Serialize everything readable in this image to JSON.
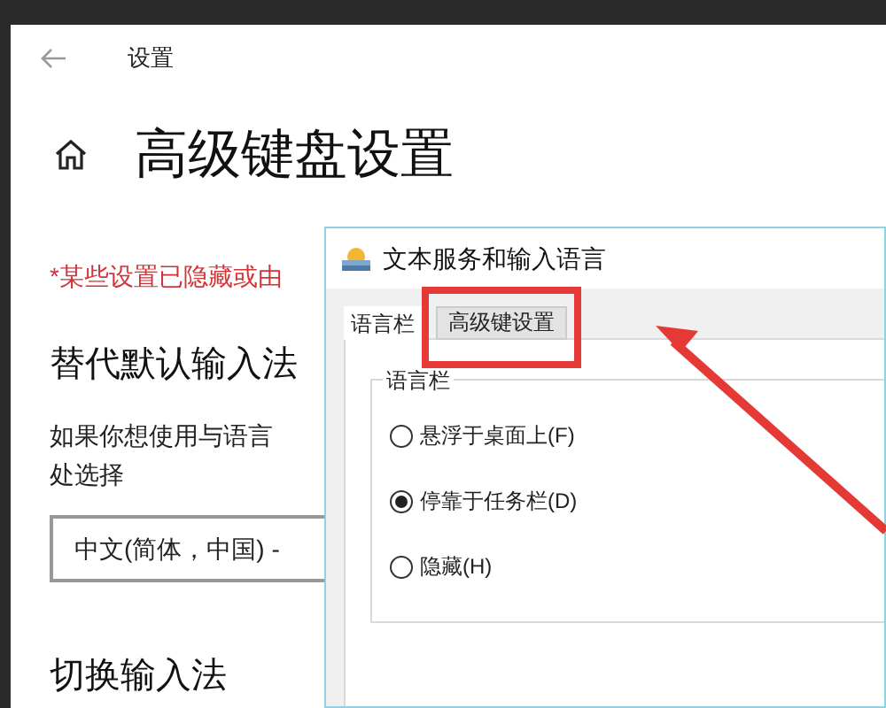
{
  "settings": {
    "header": "设置",
    "title": "高级键盘设置",
    "notice": "*某些设置已隐藏或由",
    "section_1": "替代默认输入法",
    "description_lines": [
      "如果你想使用与语言",
      "处选择"
    ],
    "dropdown": {
      "value": "中文(简体，中国) -"
    },
    "section_2": "切换输入法"
  },
  "dialog": {
    "title": "文本服务和输入语言",
    "tabs": [
      {
        "label": "语言栏",
        "selected": true,
        "highlighted": false
      },
      {
        "label": "高级键设置",
        "selected": false,
        "highlighted": true
      }
    ],
    "group": {
      "label": "语言栏",
      "options": [
        {
          "label": "悬浮于桌面上(F)",
          "selected": false
        },
        {
          "label": "停靠于任务栏(D)",
          "selected": true
        },
        {
          "label": "隐藏(H)",
          "selected": false
        }
      ]
    }
  }
}
